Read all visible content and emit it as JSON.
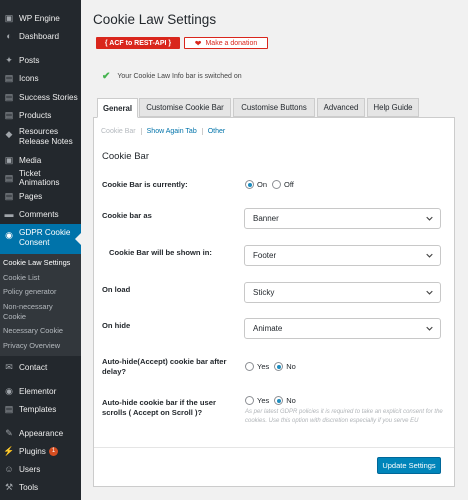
{
  "sidebar": {
    "items": [
      {
        "icon": "wordpress-icon",
        "label": "WP Engine"
      },
      {
        "icon": "dashboard-icon",
        "label": "Dashboard"
      },
      {
        "icon": "pin-icon",
        "label": "Posts"
      },
      {
        "icon": "icons-icon",
        "label": "Icons"
      },
      {
        "icon": "stories-icon",
        "label": "Success Stories"
      },
      {
        "icon": "products-icon",
        "label": "Products"
      },
      {
        "icon": "release-icon",
        "label": "Resources Release Notes"
      },
      {
        "icon": "media-icon",
        "label": "Media"
      },
      {
        "icon": "ticket-icon",
        "label": "Ticket Animations"
      },
      {
        "icon": "pages-icon",
        "label": "Pages"
      },
      {
        "icon": "comments-icon",
        "label": "Comments"
      }
    ],
    "active": {
      "icon": "cookie-icon",
      "label": "GDPR Cookie Consent"
    },
    "submenu": [
      "Cookie Law Settings",
      "Cookie List",
      "Policy generator",
      "Non-necessary Cookie",
      "Necessary Cookie",
      "Privacy Overview"
    ],
    "lower_items": [
      {
        "icon": "contact-icon",
        "label": "Contact"
      },
      {
        "icon": "elementor-icon",
        "label": "Elementor"
      },
      {
        "icon": "templates-icon",
        "label": "Templates"
      },
      {
        "icon": "appearance-icon",
        "label": "Appearance"
      },
      {
        "icon": "plugins-icon",
        "label": "Plugins",
        "badge": "1"
      },
      {
        "icon": "users-icon",
        "label": "Users"
      },
      {
        "icon": "tools-icon",
        "label": "Tools"
      }
    ]
  },
  "page": {
    "title": "Cookie Law Settings",
    "acf_button": "{ ACF to REST-API }",
    "donate_button": "Make a donation",
    "notice": "Your Cookie Law Info bar is switched on"
  },
  "tabs": [
    "General",
    "Customise Cookie Bar",
    "Customise Buttons",
    "Advanced",
    "Help Guide"
  ],
  "subnav": [
    "Cookie Bar",
    "Show Again Tab",
    "Other"
  ],
  "section_title": "Cookie Bar",
  "fields": {
    "cookie_bar_is": {
      "label": "Cookie Bar is currently:",
      "options": [
        "On",
        "Off"
      ],
      "selected": "On"
    },
    "cookie_bar_as": {
      "label": "Cookie bar as",
      "value": "Banner"
    },
    "shown_in": {
      "label": "Cookie Bar will be shown in:",
      "value": "Footer"
    },
    "on_load": {
      "label": "On load",
      "value": "Sticky"
    },
    "on_hide": {
      "label": "On hide",
      "value": "Animate"
    },
    "auto_hide_delay": {
      "label": "Auto-hide(Accept) cookie bar after delay?",
      "options": [
        "Yes",
        "No"
      ],
      "selected": "No"
    },
    "auto_hide_scroll": {
      "label": "Auto-hide cookie bar if the user scrolls ( Accept on Scroll )?",
      "options": [
        "Yes",
        "No"
      ],
      "selected": "No",
      "help": "As per latest GDPR policies it is required to take an explicit consent for the cookies. Use this option with discretion especially if you serve EU"
    }
  },
  "save_button": "Update Settings",
  "colors": {
    "sidebar": "#23282d",
    "accent": "#0073aa",
    "acf_red": "#d9261c",
    "save_blue": "#0085ba"
  }
}
